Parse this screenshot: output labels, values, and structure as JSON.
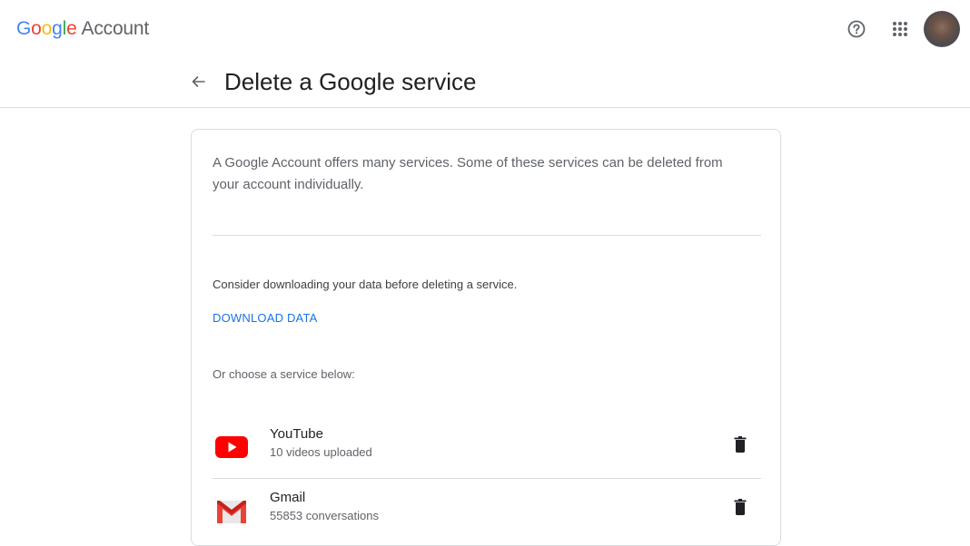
{
  "header": {
    "brand_letters": [
      "G",
      "o",
      "o",
      "g",
      "l",
      "e"
    ],
    "brand_suffix": "Account",
    "icons": [
      "help-icon",
      "apps-grid-icon",
      "avatar"
    ]
  },
  "page": {
    "title": "Delete a Google service",
    "back_icon": "arrow-back-icon"
  },
  "card": {
    "intro": "A Google Account offers many services. Some of these services can be deleted from your account individually.",
    "consider": "Consider downloading your data before deleting a service.",
    "download_label": "DOWNLOAD DATA",
    "choose": "Or choose a service below:",
    "services": [
      {
        "name": "YouTube",
        "detail": "10 videos uploaded",
        "icon": "youtube-icon",
        "action_icon": "trash-icon"
      },
      {
        "name": "Gmail",
        "detail": "55853 conversations",
        "icon": "gmail-icon",
        "action_icon": "trash-icon"
      }
    ]
  },
  "colors": {
    "link": "#1a73e8",
    "youtube_red": "#ff0000",
    "gmail_red": "#ea4335",
    "divider": "#dadce0"
  }
}
